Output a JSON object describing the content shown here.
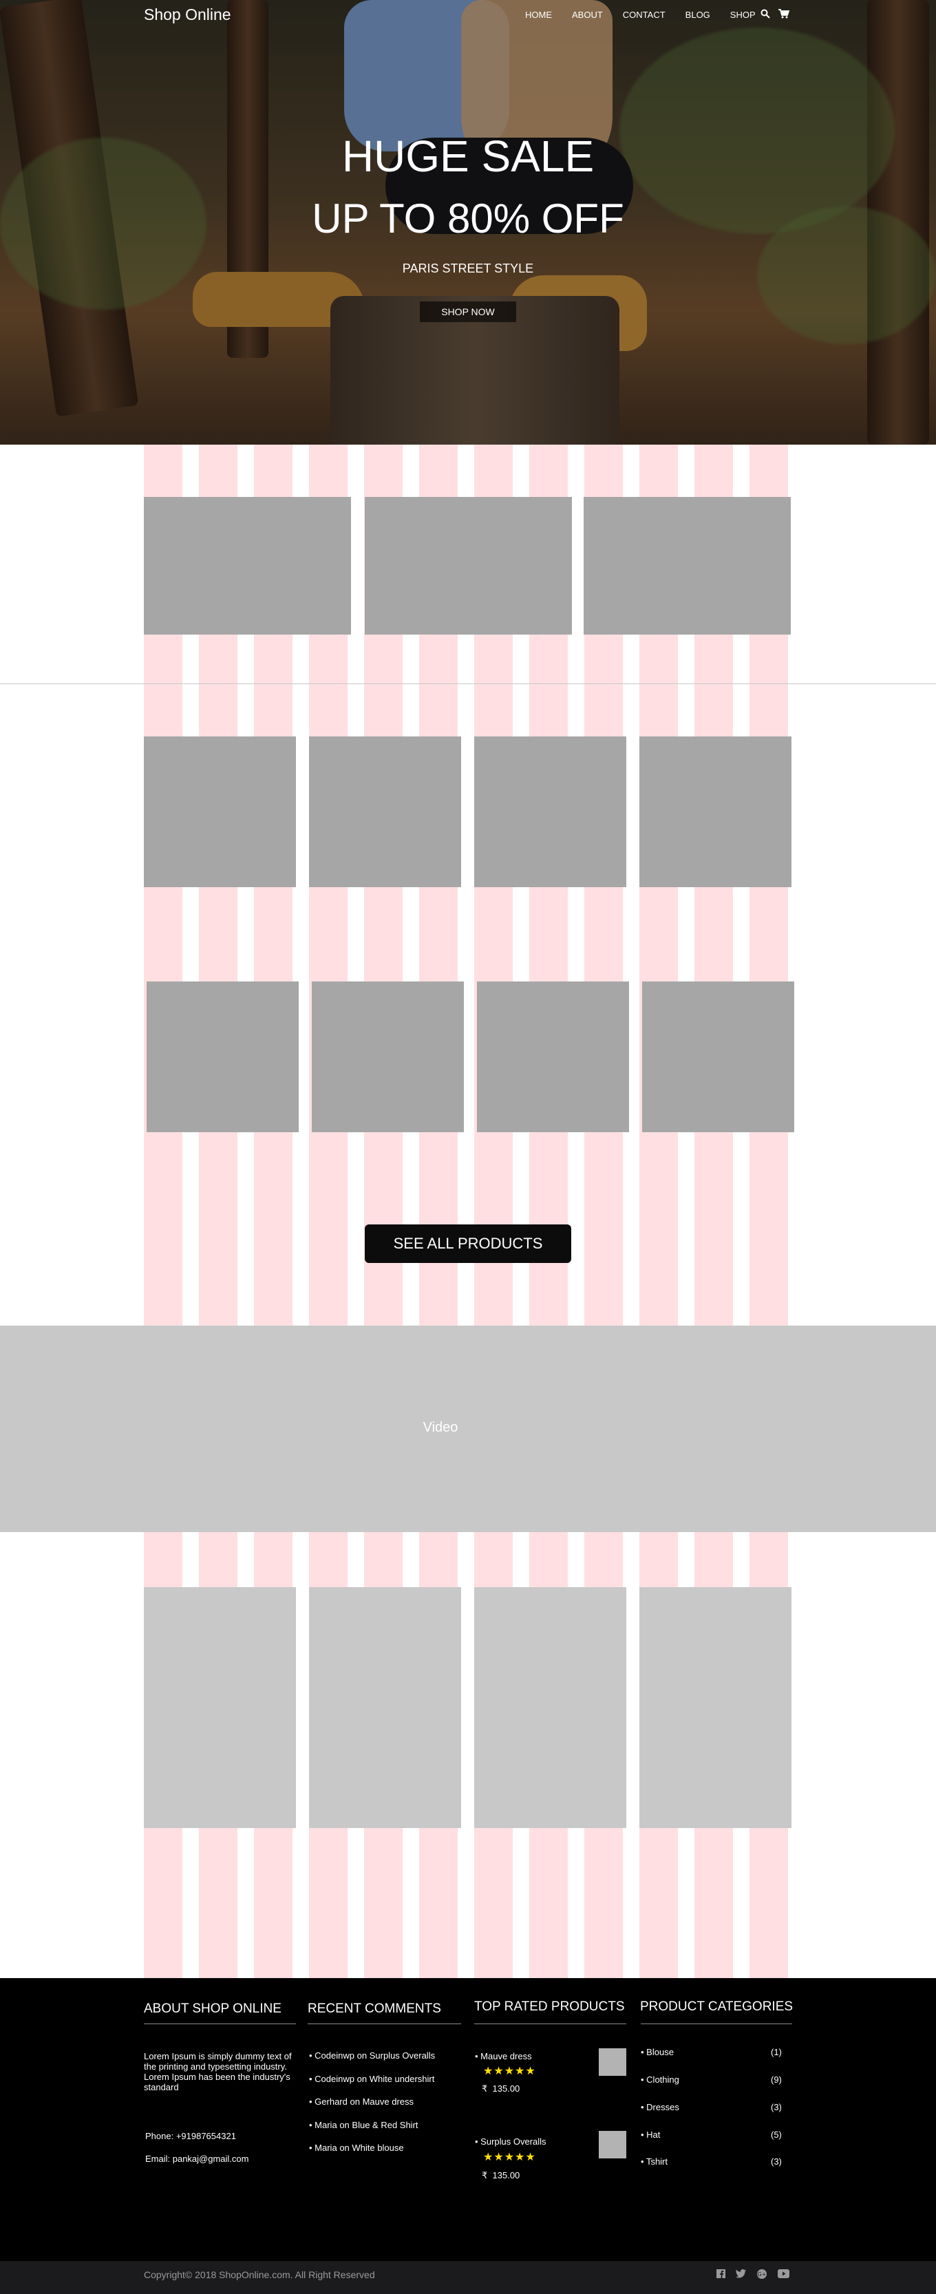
{
  "header": {
    "logo": "Shop Online",
    "nav": [
      "HOME",
      "ABOUT",
      "CONTACT",
      "BLOG",
      "SHOP"
    ],
    "icons": [
      "search-icon",
      "cart-icon"
    ]
  },
  "hero": {
    "title": "HUGE SALE",
    "subtitle": "UP TO 80% OFF",
    "tagline": "PARIS STREET STYLE",
    "button": "SHOP NOW"
  },
  "cta": {
    "label": "SEE ALL PRODUCTS"
  },
  "video": {
    "label": "Video"
  },
  "footer": {
    "about": {
      "heading": "ABOUT SHOP ONLINE",
      "text": "Lorem Ipsum is simply dummy text of the printing and typesetting industry. Lorem Ipsum has been the industry's standard",
      "phone": "Phone: +91987654321",
      "email": "Email: pankaj@gmail.com"
    },
    "comments": {
      "heading": "RECENT COMMENTS",
      "items": [
        {
          "author": "Codeinwp",
          "on": "on",
          "post": "Surplus Overalls"
        },
        {
          "author": "Codeinwp",
          "on": "on",
          "post": "White undershirt"
        },
        {
          "author": "Gerhard",
          "on": "on",
          "post": "Mauve dress"
        },
        {
          "author": "Maria",
          "on": "on",
          "post": "Blue & Red Shirt"
        },
        {
          "author": "Maria",
          "on": "on",
          "post": "White blouse"
        }
      ]
    },
    "top_rated": {
      "heading": "TOP RATED PRODUCTS",
      "items": [
        {
          "name": "Mauve dress",
          "stars": "★★★★★",
          "rating": 5,
          "currency": "₹",
          "price": "135.00"
        },
        {
          "name": "Surplus Overalls",
          "stars": "★★★★★",
          "rating": 5,
          "currency": "₹",
          "price": "135.00"
        }
      ]
    },
    "categories": {
      "heading": "PRODUCT CATEGORIES",
      "items": [
        {
          "name": "Blouse",
          "count": "(1)"
        },
        {
          "name": "Clothing",
          "count": "(9)"
        },
        {
          "name": "Dresses",
          "count": "(3)"
        },
        {
          "name": "Hat",
          "count": "(5)"
        },
        {
          "name": "Tshirt",
          "count": "(3)"
        }
      ]
    },
    "copyright": "Copyright© 2018 ShopOnline.com. All Right Reserved",
    "social": [
      "facebook-icon",
      "twitter-icon",
      "google-plus-icon",
      "youtube-icon"
    ]
  }
}
